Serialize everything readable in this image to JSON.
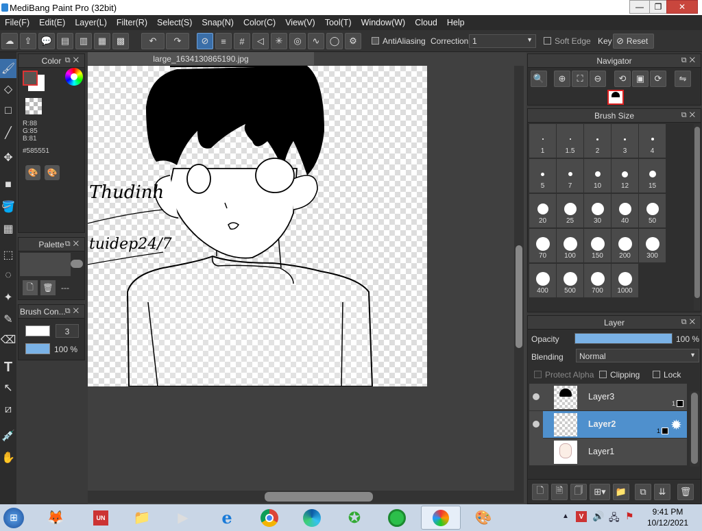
{
  "window": {
    "title": "MediBang Paint Pro (32bit)",
    "min": "—",
    "max": "❐",
    "close": "✕"
  },
  "menu": [
    "File(F)",
    "Edit(E)",
    "Layer(L)",
    "Filter(R)",
    "Select(S)",
    "Snap(N)",
    "Color(C)",
    "View(V)",
    "Tool(T)",
    "Window(W)",
    "Cloud",
    "Help"
  ],
  "toolbar": {
    "antialiasing_label": "AntiAliasing",
    "correction_label": "Correction",
    "correction_value": "1",
    "soft_edge_label": "Soft Edge",
    "key_label": "Key",
    "reset_label": "Reset"
  },
  "color_panel": {
    "title": "Color",
    "r": "R:88",
    "g": "G:85",
    "b": "B:81",
    "hex": "#585551",
    "primary_color": "#585551"
  },
  "palette_panel": {
    "title": "Palette",
    "dash": "---"
  },
  "brush_control": {
    "title": "Brush Con...",
    "size": "3",
    "opacity": "100 %"
  },
  "document": {
    "tab_name": "large_1634130865190.jpg"
  },
  "canvas_text": {
    "signature1": "Thudinh",
    "signature2": "tuidep24/7"
  },
  "navigator": {
    "title": "Navigator"
  },
  "brush_size": {
    "title": "Brush Size",
    "sizes": [
      "1",
      "1.5",
      "2",
      "3",
      "4",
      "5",
      "7",
      "10",
      "12",
      "15",
      "20",
      "25",
      "30",
      "40",
      "50",
      "70",
      "100",
      "150",
      "200",
      "300",
      "400",
      "500",
      "700",
      "1000"
    ]
  },
  "layer_panel": {
    "title": "Layer",
    "opacity_label": "Opacity",
    "opacity_value": "100 %",
    "opacity_fraction": 1.0,
    "blending_label": "Blending",
    "blending_value": "Normal",
    "protect_alpha": "Protect Alpha",
    "clipping": "Clipping",
    "lock": "Lock",
    "layers": [
      {
        "name": "Layer3",
        "selected": false,
        "badge": "1"
      },
      {
        "name": "Layer2",
        "selected": true,
        "badge": "1"
      },
      {
        "name": "Layer1",
        "selected": false,
        "badge": ""
      }
    ]
  },
  "taskbar": {
    "time": "9:41 PM",
    "date": "10/12/2021"
  },
  "colors": {
    "accent": "#4f90cd",
    "panel": "#2f2f2f",
    "toolbar_active": "#3a6ea8"
  }
}
